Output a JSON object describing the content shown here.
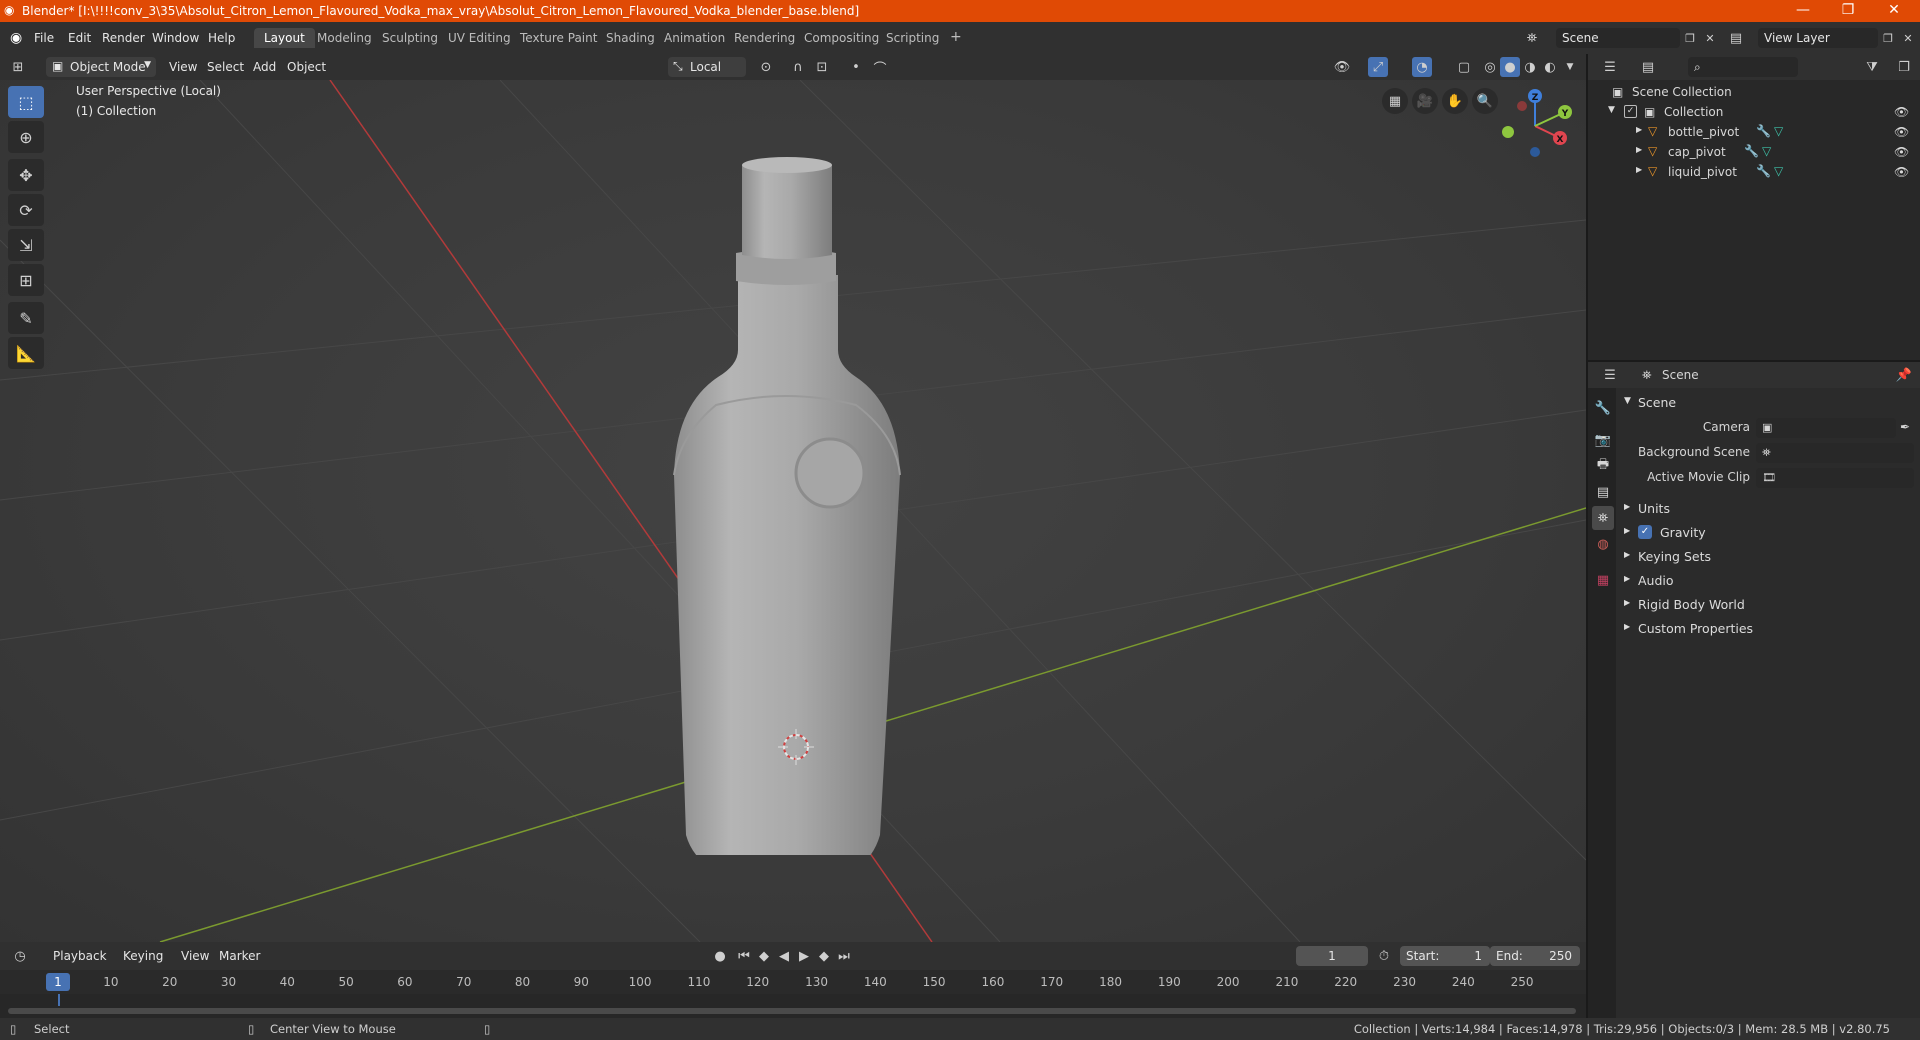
{
  "window": {
    "title": "Blender* [I:\\!!!!conv_3\\35\\Absolut_Citron_Lemon_Flavoured_Vodka_max_vray\\Absolut_Citron_Lemon_Flavoured_Vodka_blender_base.blend]",
    "minimize": "—",
    "maximize": "❐",
    "close": "✕"
  },
  "menu": [
    "File",
    "Edit",
    "Render",
    "Window",
    "Help"
  ],
  "workspaces": [
    "Layout",
    "Modeling",
    "Sculpting",
    "UV Editing",
    "Texture Paint",
    "Shading",
    "Animation",
    "Rendering",
    "Compositing",
    "Scripting"
  ],
  "workspace_add": "+",
  "scene_selector": "Scene",
  "view_layer": "View Layer",
  "viewport_header": {
    "mode": "Object Mode",
    "menus": [
      "View",
      "Select",
      "Add",
      "Object"
    ],
    "orientation": "Local"
  },
  "viewport": {
    "perspective_label": "User Perspective (Local)",
    "collection_label": "(1) Collection",
    "gizmo": {
      "x": "X",
      "y": "Y",
      "z": "Z"
    }
  },
  "outliner": {
    "root": "Scene Collection",
    "collection": "Collection",
    "objects": [
      "bottle_pivot",
      "cap_pivot",
      "liquid_pivot"
    ]
  },
  "properties": {
    "header": "Scene",
    "section": "Scene",
    "fields": [
      {
        "label": "Camera",
        "value": ""
      },
      {
        "label": "Background Scene",
        "value": ""
      },
      {
        "label": "Active Movie Clip",
        "value": ""
      }
    ],
    "panels": [
      "Units",
      "Gravity",
      "Keying Sets",
      "Audio",
      "Rigid Body World",
      "Custom Properties"
    ],
    "gravity_checked": true
  },
  "timeline": {
    "menus": [
      "Playback",
      "Keying",
      "View",
      "Marker"
    ],
    "current_frame": "1",
    "start_label": "Start:",
    "start": "1",
    "end_label": "End:",
    "end": "250",
    "ruler": [
      "1",
      "10",
      "20",
      "30",
      "40",
      "50",
      "60",
      "70",
      "80",
      "90",
      "100",
      "110",
      "120",
      "130",
      "140",
      "150",
      "160",
      "170",
      "180",
      "190",
      "200",
      "210",
      "220",
      "230",
      "240",
      "250"
    ]
  },
  "statusbar": {
    "left1": "Select",
    "left2": "Center View to Mouse",
    "stats": "Collection | Verts:14,984 | Faces:14,978 | Tris:29,956 | Objects:0/3 | Mem: 28.5 MB | v2.80.75"
  },
  "colors": {
    "title_bar": "#e04a05",
    "accent": "#4772b3",
    "x_axis": "#e0454f",
    "y_axis": "#8ec63f",
    "z_axis": "#3f7fdb"
  }
}
